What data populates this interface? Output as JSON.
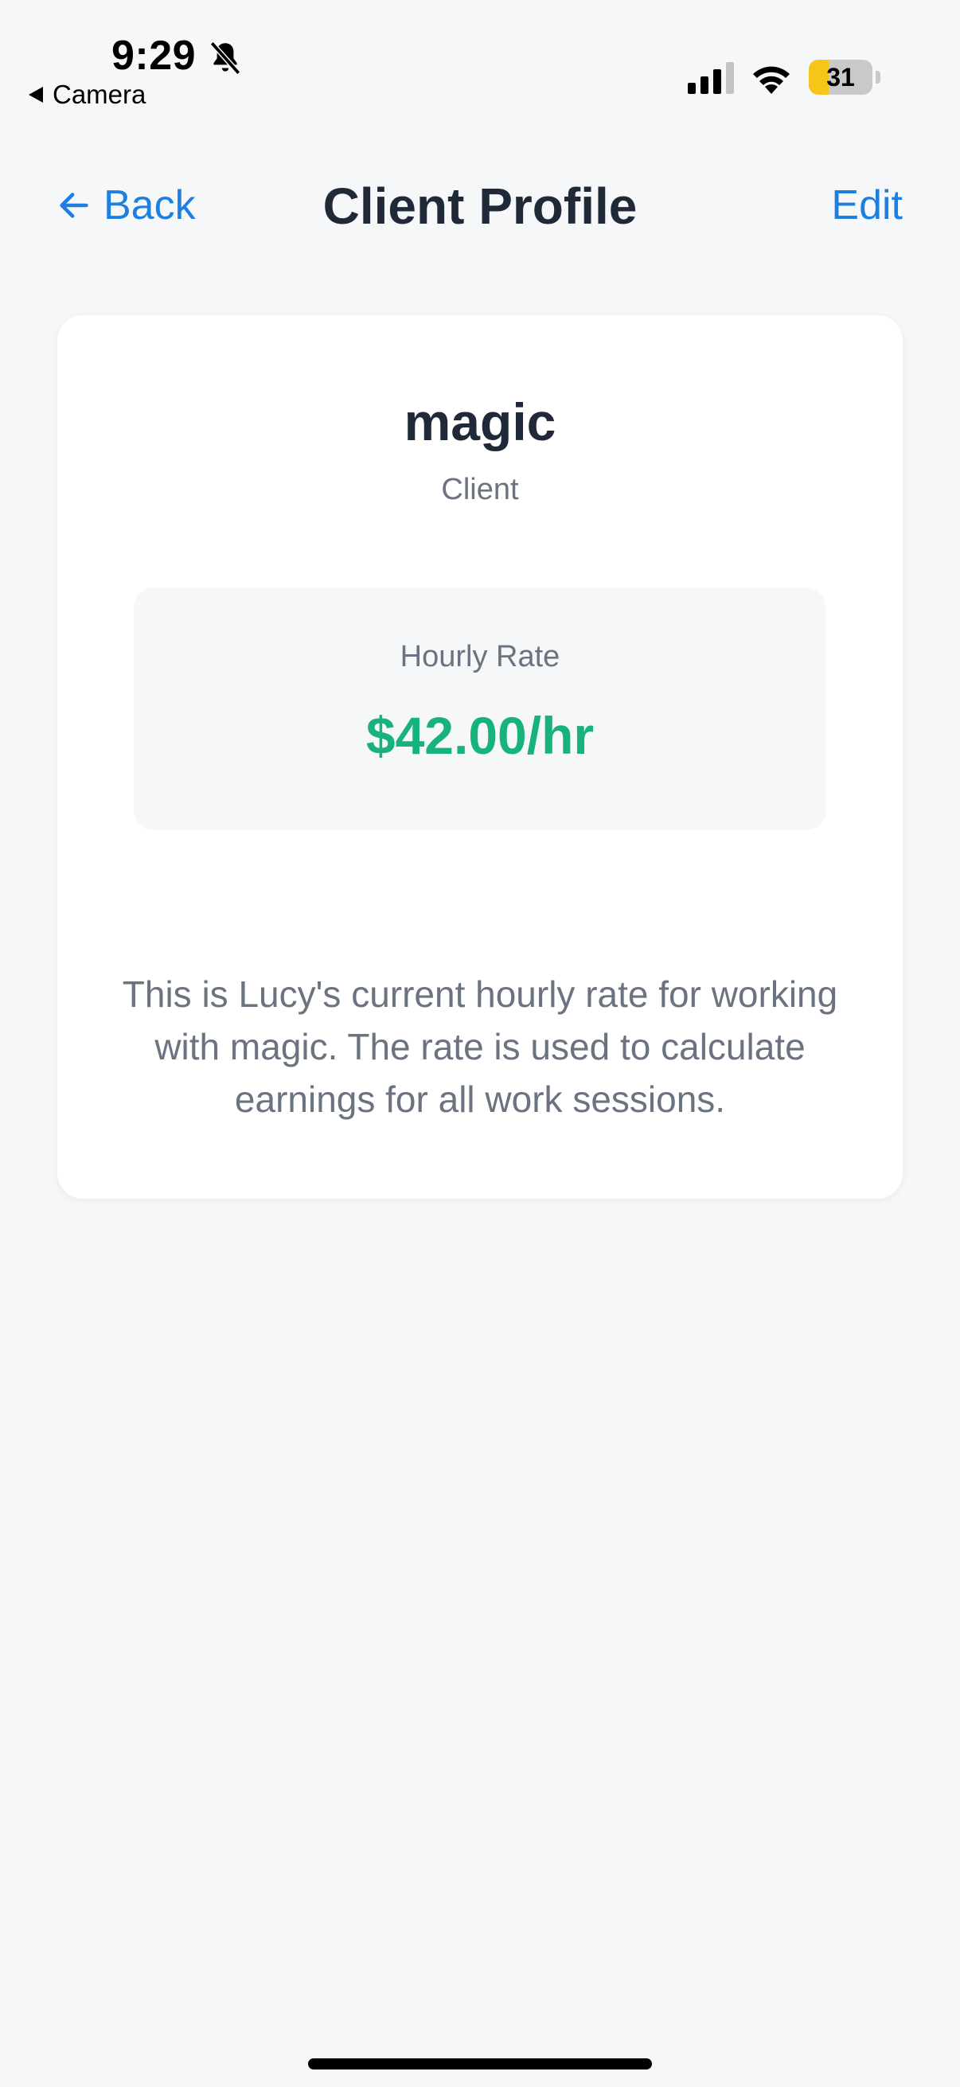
{
  "status_bar": {
    "time": "9:29",
    "back_app_label": "Camera",
    "battery_level": 31,
    "battery_label": "31",
    "icons": [
      "bell-slash-icon",
      "cellular-signal-icon",
      "wifi-icon",
      "battery-icon"
    ],
    "battery_color": "#f5c518"
  },
  "nav": {
    "back_label": "Back",
    "title": "Client Profile",
    "edit_label": "Edit",
    "accent_color": "#1d7fe0"
  },
  "client": {
    "name": "magic",
    "role": "Client"
  },
  "rate": {
    "label": "Hourly Rate",
    "value": "$42.00/hr",
    "value_color": "#17b37b",
    "description": "This is Lucy's current hourly rate for working with magic. The rate is used to calculate earnings for all work sessions."
  }
}
